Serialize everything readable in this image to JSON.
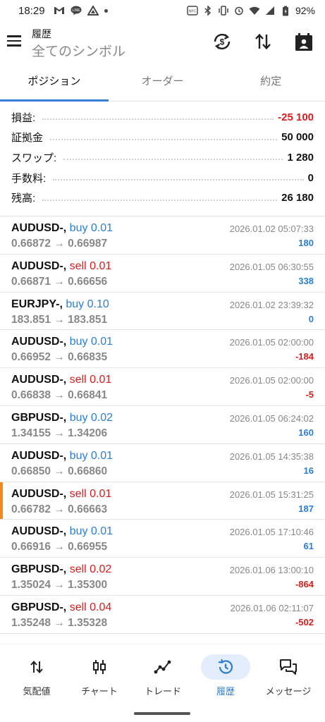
{
  "status_bar": {
    "time": "18:29",
    "battery": "92%"
  },
  "app_bar": {
    "title": "履歴",
    "subtitle": "全てのシンボル"
  },
  "tabs": [
    {
      "label": "ポジション",
      "active": true
    },
    {
      "label": "オーダー",
      "active": false
    },
    {
      "label": "約定",
      "active": false
    }
  ],
  "summary": [
    {
      "label": "損益:",
      "value": "-25 100",
      "negative": true
    },
    {
      "label": "証拠金",
      "value": "50 000",
      "negative": false
    },
    {
      "label": "スワップ:",
      "value": "1 280",
      "negative": false
    },
    {
      "label": "手数料:",
      "value": "0",
      "negative": false
    },
    {
      "label": "残高:",
      "value": "26 180",
      "negative": false
    }
  ],
  "trades": [
    {
      "symbol": "AUDUSD-,",
      "side": "buy 0.01",
      "dir": "buy",
      "prices": "0.66872 → 0.66987",
      "time": "2026.01.02 05:07:33",
      "pl": "180",
      "pl_sign": "pos"
    },
    {
      "symbol": "AUDUSD-,",
      "side": "sell 0.01",
      "dir": "sell",
      "prices": "0.66871 → 0.66656",
      "time": "2026.01.05 06:30:55",
      "pl": "338",
      "pl_sign": "pos"
    },
    {
      "symbol": "EURJPY-,",
      "side": "buy 0.10",
      "dir": "buy",
      "prices": "183.851 → 183.851",
      "time": "2026.01.02 23:39:32",
      "pl": "0",
      "pl_sign": "zero"
    },
    {
      "symbol": "AUDUSD-,",
      "side": "buy 0.01",
      "dir": "buy",
      "prices": "0.66952 → 0.66835",
      "time": "2026.01.05 02:00:00",
      "pl": "-184",
      "pl_sign": "neg"
    },
    {
      "symbol": "AUDUSD-,",
      "side": "sell 0.01",
      "dir": "sell",
      "prices": "0.66838 → 0.66841",
      "time": "2026.01.05 02:00:00",
      "pl": "-5",
      "pl_sign": "neg"
    },
    {
      "symbol": "GBPUSD-,",
      "side": "buy 0.02",
      "dir": "buy",
      "prices": "1.34155 → 1.34206",
      "time": "2026.01.05 06:24:02",
      "pl": "160",
      "pl_sign": "pos"
    },
    {
      "symbol": "AUDUSD-,",
      "side": "buy 0.01",
      "dir": "buy",
      "prices": "0.66850 → 0.66860",
      "time": "2026.01.05 14:35:38",
      "pl": "16",
      "pl_sign": "pos"
    },
    {
      "symbol": "AUDUSD-,",
      "side": "sell 0.01",
      "dir": "sell",
      "prices": "0.66782 → 0.66663",
      "time": "2026.01.05 15:31:25",
      "pl": "187",
      "pl_sign": "pos",
      "highlight": true
    },
    {
      "symbol": "AUDUSD-,",
      "side": "buy 0.01",
      "dir": "buy",
      "prices": "0.66916 → 0.66955",
      "time": "2026.01.05 17:10:46",
      "pl": "61",
      "pl_sign": "pos"
    },
    {
      "symbol": "GBPUSD-,",
      "side": "sell 0.02",
      "dir": "sell",
      "prices": "1.35024 → 1.35300",
      "time": "2026.01.06 13:00:10",
      "pl": "-864",
      "pl_sign": "neg"
    },
    {
      "symbol": "GBPUSD-,",
      "side": "sell 0.04",
      "dir": "sell",
      "prices": "1.35248 → 1.35328",
      "time": "2026.01.06 02:11:07",
      "pl": "-502",
      "pl_sign": "neg"
    }
  ],
  "bottom_nav": [
    {
      "label": "気配値",
      "icon": "swap-vertical-icon",
      "active": false
    },
    {
      "label": "チャート",
      "icon": "candlestick-icon",
      "active": false
    },
    {
      "label": "トレード",
      "icon": "trend-line-icon",
      "active": false
    },
    {
      "label": "履歴",
      "icon": "history-icon",
      "active": true
    },
    {
      "label": "メッセージ",
      "icon": "chat-icon",
      "active": false
    }
  ],
  "colors": {
    "accent": "#2a7fd4",
    "negative": "#d32020",
    "highlight": "#f08a1c"
  }
}
